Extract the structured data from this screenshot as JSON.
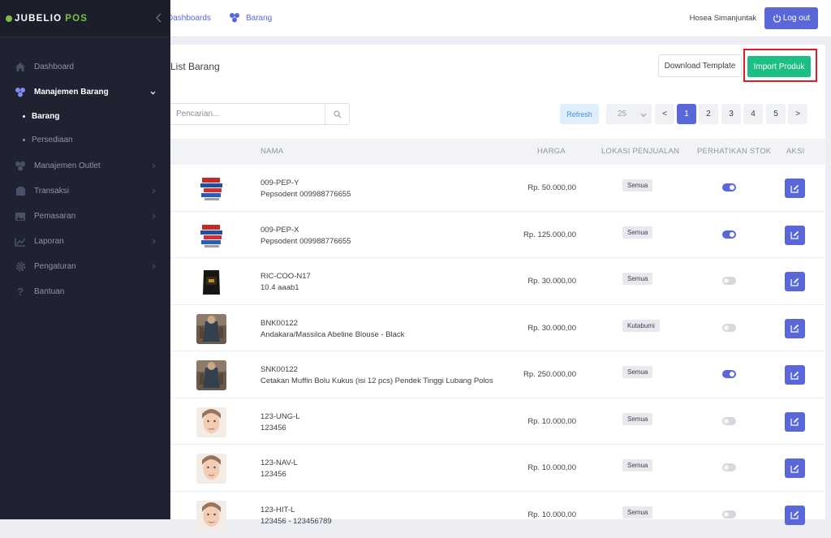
{
  "brand": {
    "name_a": "JUBELIO",
    "name_b": "POS"
  },
  "sidebar": {
    "items": [
      {
        "label": "Dashboard",
        "icon": "home-icon"
      },
      {
        "label": "Manajemen Barang",
        "icon": "boxes-icon",
        "expanded": true
      },
      {
        "label": "Barang",
        "sub": true,
        "active": true
      },
      {
        "label": "Persediaan",
        "sub": true
      },
      {
        "label": "Manajemen Outlet",
        "icon": "outlet-icon"
      },
      {
        "label": "Transaksi",
        "icon": "receipt-icon"
      },
      {
        "label": "Pemasaran",
        "icon": "image-icon"
      },
      {
        "label": "Laporan",
        "icon": "chart-icon"
      },
      {
        "label": "Pengaturan",
        "icon": "gear-icon"
      },
      {
        "label": "Bantuan",
        "icon": "question-icon"
      }
    ]
  },
  "topbar": {
    "crumb_dashboards": "Dashboards",
    "crumb_barang": "Barang",
    "user_name": "Hosea Simanjuntak",
    "logout_label": "Log out"
  },
  "main": {
    "title": "List Barang",
    "download_template_label": "Download Template",
    "import_label": "Import Produk",
    "search_placeholder": "Pencarian...",
    "refresh_label": "Refresh",
    "per_page": "25",
    "pages": [
      "<",
      "1",
      "2",
      "3",
      "4",
      "5",
      ">"
    ],
    "active_page": "1"
  },
  "table": {
    "headers": {
      "nama": "NAMA",
      "harga": "HARGA",
      "lokasi": "LOKASI PENJUALAN",
      "stok": "PERHATIKAN STOK",
      "aksi": "AKSI"
    },
    "rows": [
      {
        "sku": "009-PEP-Y",
        "name": "Pepsodent 009988776655",
        "price": "Rp. 50.000,00",
        "location": "Semua",
        "watch_stock": true,
        "thumb": "toothpaste"
      },
      {
        "sku": "009-PEP-X",
        "name": "Pepsodent 009988776655",
        "price": "Rp. 125.000,00",
        "location": "Semua",
        "watch_stock": true,
        "thumb": "toothpaste"
      },
      {
        "sku": "RIC-COO-N17",
        "name": "10.4 aaab1",
        "price": "Rp. 30.000,00",
        "location": "Semua",
        "watch_stock": false,
        "thumb": "coffee"
      },
      {
        "sku": "BNK00122",
        "name": "Andakara/Massilca Abeline Blouse - Black",
        "price": "Rp. 30.000,00",
        "location": "Kutabumi",
        "watch_stock": false,
        "thumb": "blouse"
      },
      {
        "sku": "SNK00122",
        "name": "Cetakan Muffin Bolu Kukus (isi 12 pcs) Pendek Tinggi Lubang Polos",
        "price": "Rp. 250.000,00",
        "location": "Semua",
        "watch_stock": true,
        "thumb": "blouse"
      },
      {
        "sku": "123-UNG-L",
        "name": "123456",
        "price": "Rp. 10.000,00",
        "location": "Semua",
        "watch_stock": false,
        "thumb": "face"
      },
      {
        "sku": "123-NAV-L",
        "name": "123456",
        "price": "Rp. 10.000,00",
        "location": "Semua",
        "watch_stock": false,
        "thumb": "face"
      },
      {
        "sku": "123-HIT-L",
        "name": "123456 - 123456789",
        "price": "Rp. 10.000,00",
        "location": "Semua",
        "watch_stock": false,
        "thumb": "face"
      }
    ]
  },
  "colors": {
    "accent": "#5a67d8",
    "import_green": "#1dbf85",
    "highlight_red": "#e31b23",
    "sidebar_bg": "#1f2230",
    "brand_green": "#7bc043"
  }
}
